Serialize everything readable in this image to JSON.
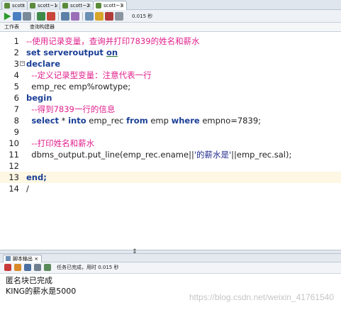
{
  "tabs": [
    {
      "label": "scott",
      "active": false
    },
    {
      "label": "scott~1",
      "active": false
    },
    {
      "label": "scott~2",
      "active": false
    },
    {
      "label": "scott~3",
      "active": true
    }
  ],
  "toolbar": {
    "timer": "0.015 秒",
    "icons": [
      "run-icon",
      "run-script-icon",
      "commit-icon",
      "rollback-icon",
      "sql-tuning-icon",
      "explain-plan-icon",
      "autotrace-icon",
      "clear-icon",
      "format-icon",
      "history-icon"
    ]
  },
  "subtabs": {
    "worksheet": "工作表",
    "query_builder": "查询构建器"
  },
  "editor": {
    "lines": [
      {
        "n": "1",
        "segments": [
          {
            "t": "--使用记录变量，查询并打印7839的姓名和薪水",
            "c": "cm"
          }
        ]
      },
      {
        "n": "2",
        "segments": [
          {
            "t": "set serveroutput ",
            "c": "kw"
          },
          {
            "t": "on",
            "c": "kw ul"
          }
        ]
      },
      {
        "n": "3",
        "segments": [
          {
            "t": "declare",
            "c": "kw"
          }
        ],
        "fold": true
      },
      {
        "n": "4",
        "segments": [
          {
            "t": "  --定义记录型变量：注意代表一行",
            "c": "cm"
          }
        ]
      },
      {
        "n": "5",
        "segments": [
          {
            "t": "  emp_rec emp%rowtype;",
            "c": ""
          }
        ]
      },
      {
        "n": "6",
        "segments": [
          {
            "t": "begin",
            "c": "kw"
          }
        ]
      },
      {
        "n": "7",
        "segments": [
          {
            "t": "  --得到7839一行的信息",
            "c": "cm"
          }
        ]
      },
      {
        "n": "8",
        "segments": [
          {
            "t": "  ",
            "c": ""
          },
          {
            "t": "select",
            "c": "kw"
          },
          {
            "t": " * ",
            "c": ""
          },
          {
            "t": "into",
            "c": "kw"
          },
          {
            "t": " emp_rec ",
            "c": ""
          },
          {
            "t": "from",
            "c": "kw"
          },
          {
            "t": " emp ",
            "c": ""
          },
          {
            "t": "where",
            "c": "kw"
          },
          {
            "t": " empno=7839;",
            "c": ""
          }
        ]
      },
      {
        "n": "9",
        "segments": [
          {
            "t": "",
            "c": ""
          }
        ]
      },
      {
        "n": "10",
        "segments": [
          {
            "t": "  --打印姓名和薪水",
            "c": "cm"
          }
        ]
      },
      {
        "n": "11",
        "segments": [
          {
            "t": "  dbms_output.put_line(emp_rec.ename||",
            "c": ""
          },
          {
            "t": "'的薪水是'",
            "c": "str"
          },
          {
            "t": "||emp_rec.sal);",
            "c": ""
          }
        ]
      },
      {
        "n": "12",
        "segments": [
          {
            "t": "",
            "c": ""
          }
        ]
      },
      {
        "n": "13",
        "segments": [
          {
            "t": "end;",
            "c": "kw"
          }
        ],
        "highlight": true
      },
      {
        "n": "14",
        "segments": [
          {
            "t": "/",
            "c": ""
          }
        ]
      }
    ]
  },
  "output_panel": {
    "tab_label": "脚本输出",
    "status": "任务已完成，用时 0.015 秒",
    "lines": [
      "匿名块已完成",
      "KING的薪水是5000"
    ],
    "watermark": "https://blog.csdn.net/weixin_41761540"
  }
}
